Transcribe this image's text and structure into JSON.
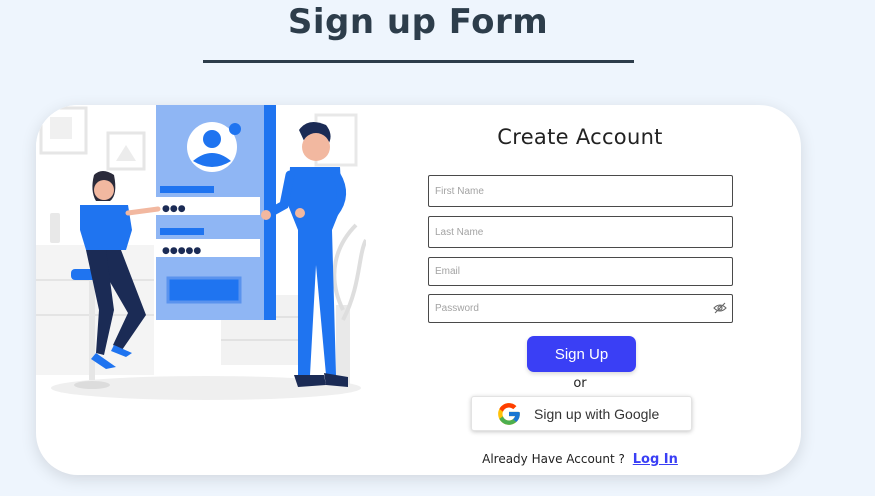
{
  "page": {
    "title": "Sign up Form"
  },
  "form": {
    "heading": "Create Account",
    "first_name_placeholder": "First Name",
    "last_name_placeholder": "Last Name",
    "email_placeholder": "Email",
    "password_placeholder": "Password",
    "signup_label": "Sign Up",
    "or_text": "or",
    "google_label": "Sign up with Google",
    "footer_text": "Already Have Account ?",
    "login_label": "Log In"
  },
  "illustration": {
    "password_dots_1": "●●●",
    "password_dots_2": "●●●●●"
  },
  "colors": {
    "primary": "#3a3ff5",
    "title": "#2d3d4b",
    "background": "#eef5fd",
    "illustration_blue": "#1f74f0"
  },
  "icons": {
    "password_toggle": "eye-off-icon",
    "google": "google-logo-icon"
  }
}
